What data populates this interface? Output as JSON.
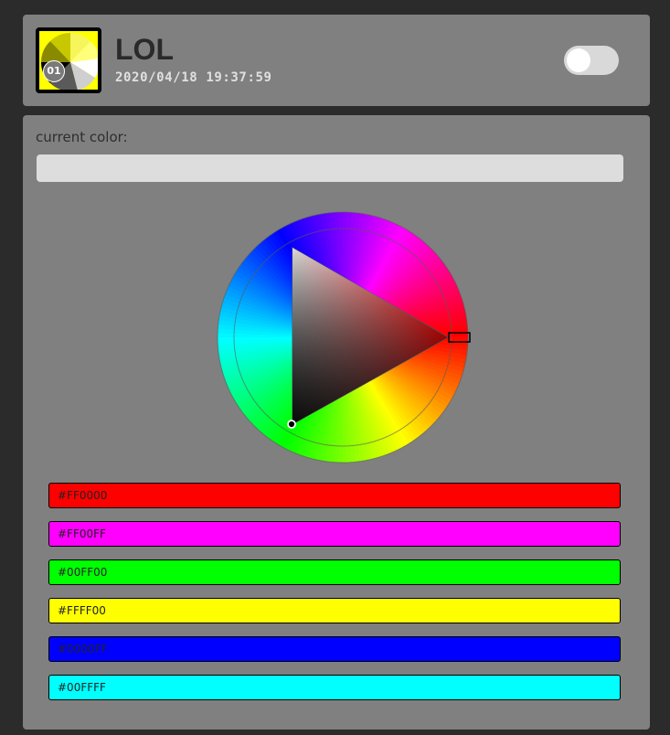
{
  "header": {
    "title": "LOL",
    "timestamp": "2020/04/18 19:37:59",
    "badge": "01",
    "logo_color": "#FFFF00"
  },
  "toggle": {
    "state": "off",
    "icon": "toggle-switch"
  },
  "current_color": {
    "label": "current color:",
    "swatch_color": "#DDDDDD"
  },
  "picker": {
    "hue_marker": "hue-marker",
    "sv_marker": "saturation-value-marker",
    "selected_hue_color": "#FF0000"
  },
  "swatches": [
    {
      "label": "#FF0000",
      "color": "#FF0000"
    },
    {
      "label": "#FF00FF",
      "color": "#FF00FF"
    },
    {
      "label": "#00FF00",
      "color": "#00FF00"
    },
    {
      "label": "#FFFF00",
      "color": "#FFFF00"
    },
    {
      "label": "#0000FF",
      "color": "#0000FF"
    },
    {
      "label": "#00FFFF",
      "color": "#00FFFF"
    }
  ]
}
